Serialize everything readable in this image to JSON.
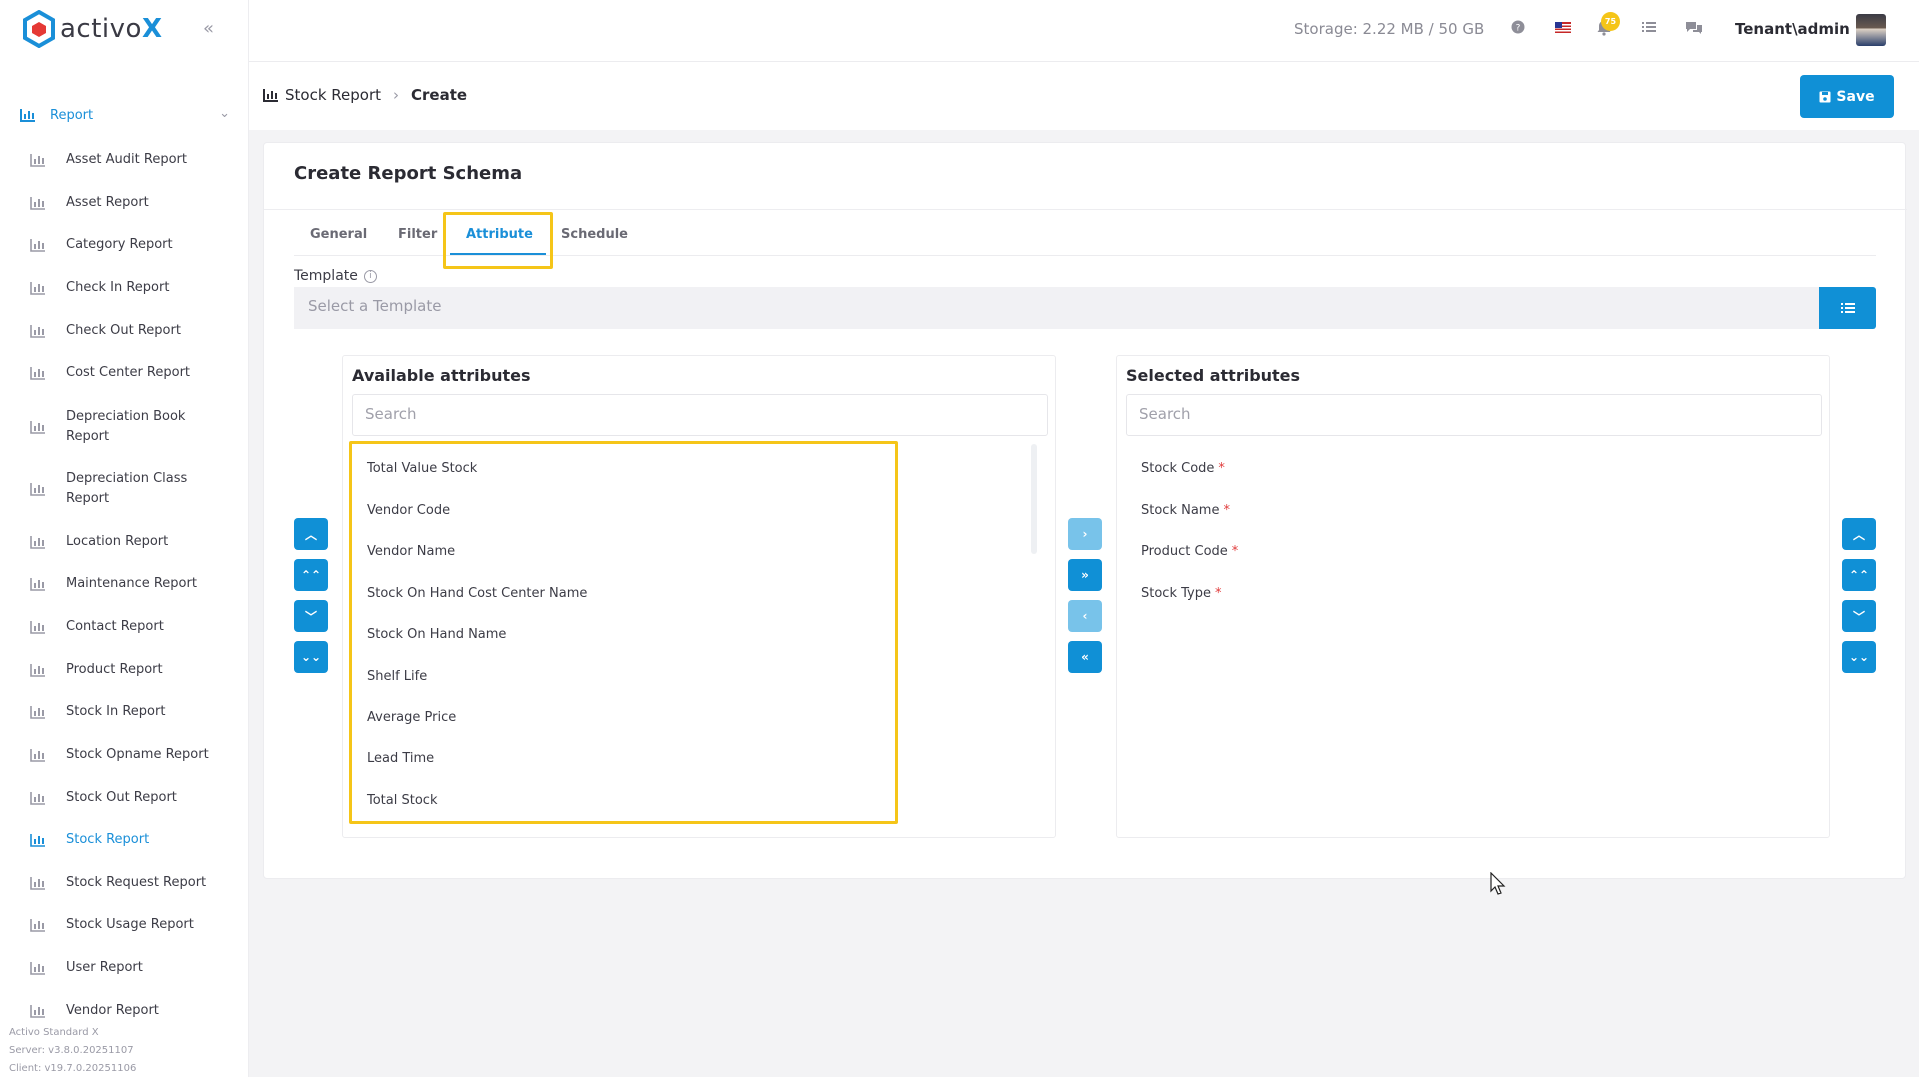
{
  "app": {
    "logo_text": "activo",
    "logo_x": "X"
  },
  "sidebar": {
    "section": "Report",
    "items": [
      {
        "label": "Asset Audit Report"
      },
      {
        "label": "Asset Report"
      },
      {
        "label": "Category Report"
      },
      {
        "label": "Check In Report"
      },
      {
        "label": "Check Out Report"
      },
      {
        "label": "Cost Center Report"
      },
      {
        "label": "Depreciation Book Report"
      },
      {
        "label": "Depreciation Class Report"
      },
      {
        "label": "Location Report"
      },
      {
        "label": "Maintenance Report"
      },
      {
        "label": "Contact Report"
      },
      {
        "label": "Product Report"
      },
      {
        "label": "Stock In Report"
      },
      {
        "label": "Stock Opname Report"
      },
      {
        "label": "Stock Out Report"
      },
      {
        "label": "Stock Report"
      },
      {
        "label": "Stock Request Report"
      },
      {
        "label": "Stock Usage Report"
      },
      {
        "label": "User Report"
      },
      {
        "label": "Vendor Report"
      }
    ],
    "active_item": "Stock Report",
    "footer": {
      "product": "Activo Standard X",
      "server": "Server: v3.8.0.20251107",
      "client": "Client: v19.7.0.20251106"
    }
  },
  "topbar": {
    "storage": "Storage: 2.22 MB / 50 GB",
    "notification_count": "75",
    "user": "Tenant\\admin"
  },
  "header": {
    "breadcrumb_root": "Stock Report",
    "breadcrumb_current": "Create",
    "save_label": "Save"
  },
  "card": {
    "title": "Create Report Schema",
    "tabs": [
      "General",
      "Filter",
      "Attribute",
      "Schedule"
    ],
    "active_tab": "Attribute",
    "template_label": "Template",
    "template_placeholder": "Select a Template"
  },
  "available": {
    "title": "Available attributes",
    "search_placeholder": "Search",
    "items": [
      "Total Value Stock",
      "Vendor Code",
      "Vendor Name",
      "Stock On Hand Cost Center Name",
      "Stock On Hand Name",
      "Shelf Life",
      "Average Price",
      "Lead Time",
      "Total Stock"
    ]
  },
  "selected": {
    "title": "Selected attributes",
    "search_placeholder": "Search",
    "items": [
      "Stock Code",
      "Stock Name",
      "Product Code",
      "Stock Type"
    ],
    "required_mark": "*"
  },
  "colors": {
    "accent": "#1090d6",
    "highlight": "#f5c518",
    "required": "#e03b3b"
  }
}
